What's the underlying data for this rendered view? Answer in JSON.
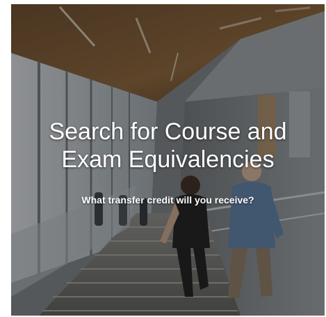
{
  "promo_card": {
    "headline_line1": "Search for Course and",
    "headline_line2": "Exam Equivalencies",
    "subheadline": "What transfer credit will you receive?",
    "background_image": "students-climbing-stairs-in-atrium-photo"
  },
  "colors": {
    "text": "#ffffff",
    "overlay": "#141414"
  }
}
